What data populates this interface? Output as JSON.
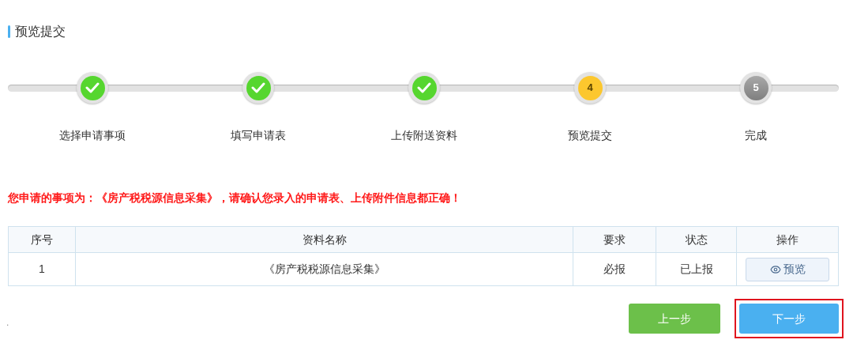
{
  "section_title": "预览提交",
  "steps": [
    {
      "label": "选择申请事项",
      "kind": "done"
    },
    {
      "label": "填写申请表",
      "kind": "done"
    },
    {
      "label": "上传附送资料",
      "kind": "done"
    },
    {
      "label": "预览提交",
      "kind": "current",
      "number": "4"
    },
    {
      "label": "完成",
      "kind": "todo",
      "number": "5"
    }
  ],
  "notice": "您申请的事项为：《房产税税源信息采集》，请确认您录入的申请表、上传附件信息都正确！",
  "table": {
    "columns": [
      "序号",
      "资料名称",
      "要求",
      "状态",
      "操作"
    ],
    "rows": [
      {
        "index": "1",
        "name": "《房产税税源信息采集》",
        "requirement": "必报",
        "status": "已上报",
        "action": "预览"
      }
    ]
  },
  "footnote_mark": ".",
  "buttons": [
    {
      "label": "上一步",
      "kind": "prev",
      "highlighted": false
    },
    {
      "label": "下一步",
      "kind": "next",
      "highlighted": true
    }
  ]
}
